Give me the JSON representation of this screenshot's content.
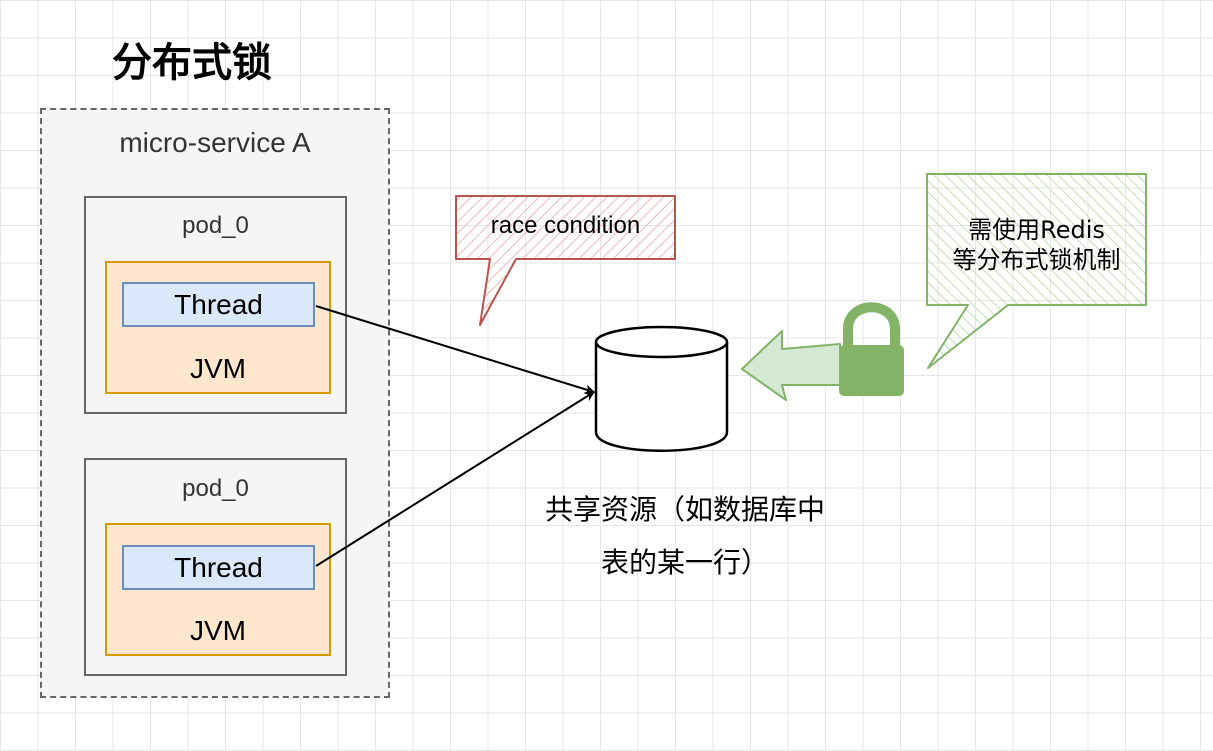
{
  "title": "分布式锁",
  "service": {
    "label": "micro-service A"
  },
  "pods": [
    {
      "label": "pod_0",
      "thread_label": "Thread",
      "jvm_label": "JVM"
    },
    {
      "label": "pod_0",
      "thread_label": "Thread",
      "jvm_label": "JVM"
    }
  ],
  "resource": {
    "line1": "共享资源（如数据库中",
    "line2": "表的某一行）"
  },
  "race_callout": {
    "text": "race condition"
  },
  "lock_callout": {
    "line1": "需使用Redis",
    "line2": "等分布式锁机制"
  },
  "icons": {
    "lock": "lock-icon",
    "arrow": "arrow-left-icon",
    "database": "database-icon"
  },
  "colors": {
    "race_stroke": "#b85450",
    "race_fill": "#f8cecc",
    "lock_green": "#82b366",
    "lock_fill": "#d5e8d4"
  }
}
